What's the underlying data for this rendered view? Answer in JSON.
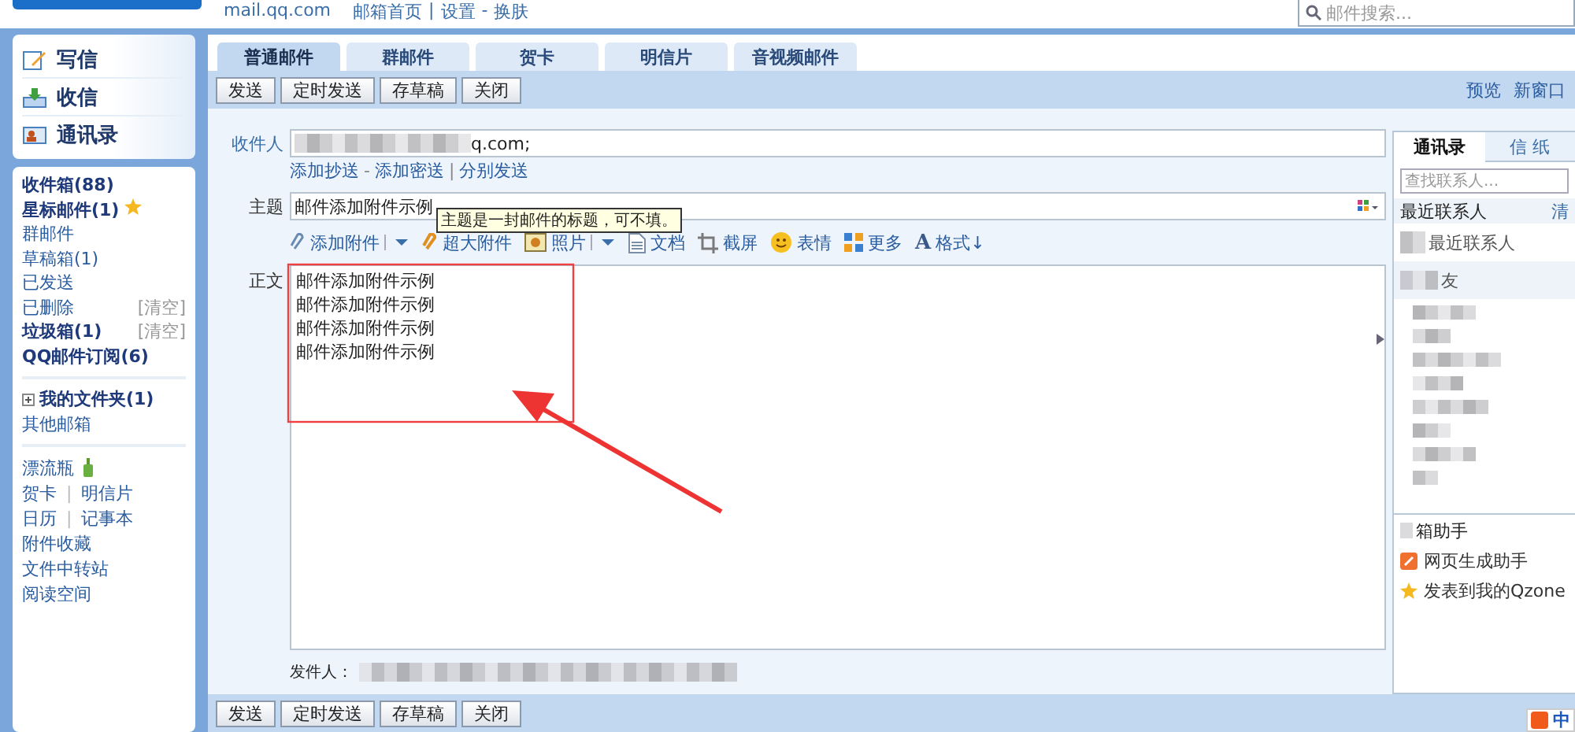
{
  "header": {
    "domain": "mail.qq.com",
    "links": [
      "邮箱首页",
      "|",
      "设置",
      "-",
      "换肤"
    ],
    "search": {
      "placeholder": "邮件搜索..."
    }
  },
  "sidebar": {
    "actions": [
      {
        "label": "写信",
        "kind": "write"
      },
      {
        "label": "收信",
        "kind": "inbox"
      },
      {
        "label": "通讯录",
        "kind": "contacts"
      }
    ],
    "folders": [
      {
        "label": "收件箱(88)",
        "bold": true
      },
      {
        "label": "星标邮件(1)",
        "bold": true,
        "star": true
      },
      {
        "label": "群邮件",
        "bold": false
      },
      {
        "label": "草稿箱(1)",
        "bold": false
      },
      {
        "label": "已发送",
        "bold": false
      },
      {
        "label": "已删除",
        "bold": false,
        "action": "[清空]"
      },
      {
        "label": "垃圾箱(1)",
        "bold": true,
        "action": "[清空]"
      },
      {
        "label": "QQ邮件订阅(6)",
        "bold": true
      }
    ],
    "my_folders": {
      "label": "我的文件夹(1)",
      "expanded": false
    },
    "other_box": "其他邮箱",
    "tools": [
      {
        "items": [
          "漂流瓶"
        ],
        "kind": "bottle"
      },
      {
        "items": [
          "贺卡",
          "|",
          "明信片"
        ]
      },
      {
        "items": [
          "日历",
          "|",
          "记事本"
        ]
      },
      {
        "items": [
          "附件收藏"
        ]
      },
      {
        "items": [
          "文件中转站"
        ]
      },
      {
        "items": [
          "阅读空间"
        ]
      }
    ]
  },
  "tabs": [
    {
      "label": "普通邮件",
      "selected": true
    },
    {
      "label": "群邮件",
      "selected": false
    },
    {
      "label": "贺卡",
      "selected": false
    },
    {
      "label": "明信片",
      "selected": false
    },
    {
      "label": "音视频邮件",
      "selected": false
    }
  ],
  "toolbar_top": [
    "发送",
    "定时发送",
    "存草稿",
    "关闭"
  ],
  "toolbar_links": [
    "预览",
    "新窗口"
  ],
  "form": {
    "recipient": {
      "label": "收件人",
      "value": "q.com;"
    },
    "recipient_links": [
      {
        "kind": "link",
        "text": "添加抄送"
      },
      {
        "kind": "sep",
        "text": "-"
      },
      {
        "kind": "link",
        "text": "添加密送"
      },
      {
        "kind": "sep",
        "text": "|"
      },
      {
        "kind": "link",
        "text": "分别发送"
      }
    ],
    "subject": {
      "label": "主题",
      "value": "邮件添加附件示例",
      "tooltip": "主题是一封邮件的标题，可不填。"
    },
    "editor_tools": [
      {
        "label": "添加附件",
        "kind": "clip",
        "dropdown": true
      },
      {
        "label": "超大附件",
        "kind": "bigclip",
        "dropdown": false
      },
      {
        "label": "照片",
        "kind": "photo",
        "dropdown": true
      },
      {
        "label": "文档",
        "kind": "doc",
        "dropdown": false
      },
      {
        "label": "截屏",
        "kind": "screenshot",
        "dropdown": false
      },
      {
        "label": "表情",
        "kind": "smiley",
        "dropdown": false
      },
      {
        "label": "更多",
        "kind": "grid",
        "dropdown": false
      },
      {
        "label": "格式↓",
        "kind": "font",
        "glyph": "A",
        "dropdown": false
      }
    ],
    "body": {
      "label": "正文",
      "lines": [
        "邮件添加附件示例",
        "邮件添加附件示例",
        "邮件添加附件示例",
        "邮件添加附件示例"
      ]
    },
    "sender": {
      "label": "发件人："
    }
  },
  "contacts": {
    "tabs": [
      {
        "label": "通讯录",
        "selected": true
      },
      {
        "label": "信 纸",
        "selected": false
      }
    ],
    "search": {
      "placeholder": "查找联系人..."
    },
    "recent": {
      "title": "最近联系人",
      "action": "清",
      "empty": "最近联系人"
    },
    "group": "友",
    "helper": {
      "title": "箱助手",
      "items": [
        {
          "label": "网页生成助手",
          "kind": "page"
        },
        {
          "label": "发表到我的Qzone",
          "kind": "star"
        }
      ]
    }
  },
  "toolbar_bottom": [
    "发送",
    "定时发送",
    "存草稿",
    "关闭"
  ],
  "ime": {
    "label": "中"
  }
}
